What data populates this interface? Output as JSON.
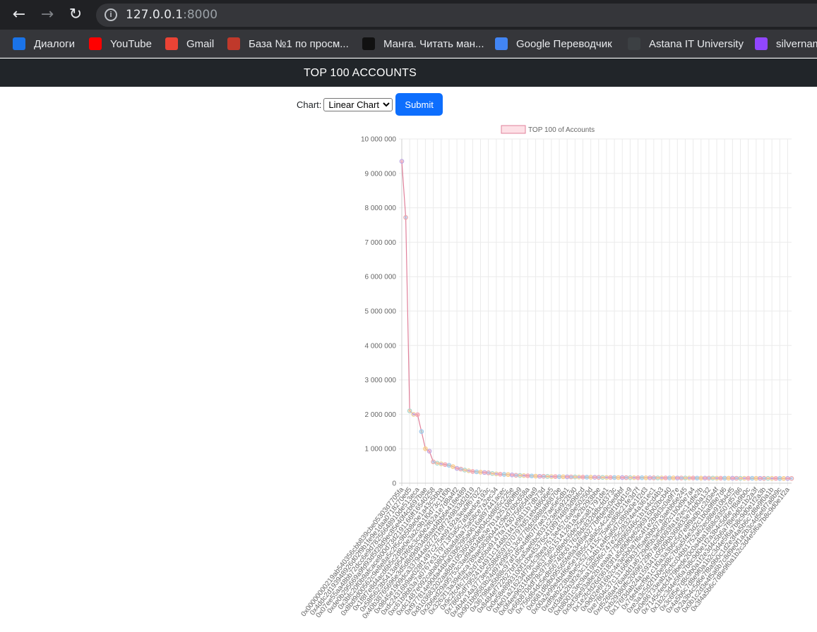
{
  "browser": {
    "url_host": "127.0.0.1",
    "url_port": ":8000",
    "bookmarks": [
      {
        "label": "Диалоги",
        "icon": "chat-icon",
        "color": "#1a73e8"
      },
      {
        "label": "YouTube",
        "icon": "youtube-icon",
        "color": "#ff0000"
      },
      {
        "label": "Gmail",
        "icon": "gmail-icon",
        "color": "#ea4335"
      },
      {
        "label": "База №1 по просм...",
        "icon": "mascot-icon",
        "color": "#c0392b"
      },
      {
        "label": "Манга. Читать ман...",
        "icon": "manga-icon",
        "color": "#111111"
      },
      {
        "label": "Google Переводчик",
        "icon": "translate-icon",
        "color": "#4285f4"
      },
      {
        "label": "Astana IT University",
        "icon": "university-icon",
        "color": "#3c4043"
      },
      {
        "label": "silvernam",
        "icon": "twitch-icon",
        "color": "#9146ff"
      }
    ]
  },
  "navbar": {
    "title": "TOP 100 ACCOUNTS"
  },
  "form": {
    "label": "Chart:",
    "options": [
      "Linear Chart"
    ],
    "selected": "Linear Chart",
    "submit_label": "Submit"
  },
  "chart_data": {
    "type": "line",
    "legend": [
      "TOP 100 of Accounts"
    ],
    "legend_position": "top",
    "ylim": [
      0,
      10000000
    ],
    "yticks": [
      "0",
      "1 000 000",
      "2 000 000",
      "3 000 000",
      "4 000 000",
      "5 000 000",
      "6 000 000",
      "7 000 000",
      "8 000 000",
      "9 000 000",
      "10 000 000"
    ],
    "grid": true,
    "colors": {
      "line": "#e0809a",
      "fill": "#fde0e6"
    },
    "categories": [
      "0x00000000219ab540356cbb839cbe05303d7705fa",
      "0x73bceb1cd57c711feac4224d062b0f6ff338501e",
      "0x4ddc2d193948926d02f9b1fe9e1daa0718270ed5",
      "0x1b3cb81e51011b549d78bf720b0d924ac763a7c2",
      "0x07ee55aa48bb72dcc6e9d78256648910de513eca",
      "0x9778f4e80e4eadeb0d7caa15e8b4a2e4d2c0a3b1",
      "0xde0b295669a9fd93d5f28d9ec85e40f4cb697bae",
      "0xca8fa8f0b631ecdb18cda619c4fc9d197c8affca",
      "0x3bfc20f0b9afcace800d73d2191166ff16540258",
      "0x0a4c79ce84202b03e95b7a692e5d728d83c44c76",
      "0x8bd9d00562c9e8e8a5c2f5c9b5b8e0e1a43c5bba",
      "0x0548f59fee79f8832c299e01dca5c76f034f558e",
      "0x1f8f7e8d4acd6b5c2d8e0e3a2c9b1f0d73c11f0b",
      "0x2faf487a4414fe77e2327f0bf4ae2a264a776ad2",
      "0x58f5623b5413a9542f69c3ca0e2f62a1e7d8a4f2",
      "0x5a52e96bacdabb82fd05763e25335261b270efcb",
      "0x40b38765696e3d5d8d9d834d8aad4bb6e418e489",
      "0x189b9cbd4aff470af2c0102f365fc1823d857965",
      "0x9845e1909dca337944a0272f1f9f7249833d2d19",
      "0xb8808f9e9b88497ec522304055cd537a0913f6a0",
      "0xdc24316b9ae028f1497c275eb9192a3ea0f67022",
      "0x61edcdf5bb737adffe5043706e7c5bb1f1a56eea",
      "0xc61b9bb3a7a0767e3179713f3a5c7a9aedce193c",
      "0x1db92e2eebc8e0c075a02bea49a2935bcd2dfcf4",
      "0xdc1487e092caba080c6badafaa75a58ce7a2ec34",
      "0x7a250d5630b4cf539739df2c5dacb4c659f2488d",
      "0xf977814e90da44bfa03b6295a0616a897441acec",
      "0xe92d1a43df510f82c66382592a047d288f85226f",
      "0x8103683202aa8da10536036edef04cdd865c225e",
      "0x0c23fc0ef06716d2f8ba19bc4bed56d045581f2d",
      "0x2b6ed29a95753c3ad948348e3e7b1a251080ffb9",
      "0x701c484bfb40ac628afa487b6082f084b14af0bd",
      "0x3262f13a39efaca789ae58390441c9ed76bc658a",
      "0x0a869d79a7052c7f1b55a8ebabbea3420f0d1e13",
      "0x9c2fc4fc75fa2d7eb5ba9147fa7430756654faa9",
      "0xb20411c403687d1036e05c8a7310a0f218429503",
      "0x78605df79524164911c144801f41e9811b7db73d",
      "0x36a85757645e8e8aec062a1dee289c7d615901ca",
      "0x4b4e14a3773ee558b6597070797fd51eb48606e5",
      "0xa7e4fecddc20d83f36971b67e13f1abc98dfcfa6",
      "0x901bb9583b24d97e995513c6778dc6888ab6870e",
      "0xc3c7f8e3d8ea35ec3ad8ec1d7b2d0a4b1a3c2e6f",
      "0x36798ea5b88c97af1d5e4dff07f7ae37ae5e5db1",
      "0xe04f27eb70e025b78871a2ad7eabe85e61212761",
      "0x8484ef722627bf18ca5ae6bcf031c23e6e922b30",
      "0x6b44ba0a126a2a1a8aa6cd1adeed002e141bcd44",
      "0x0e58e8993100f1cbe45376c410f97f4893d9bfcd",
      "0x19184ab45c40c2920b0e0e31413b9434abd243ed",
      "0xfe01a216234f79cfc3bea7513e457c6a9e50250d",
      "0x4862733b5fddfd35f35ea8ccf08f5045e57388b3",
      "0x0f4ee9631f4be0a63756515141281a3e2b293bbe",
      "0xbf3aeb96e164ae67e763d9e050ff124e7c3fdd28",
      "0x66b870ddf78c975af5cd8edc6de25eca81791de1",
      "0x8fe78a3f3d3f5a2d5c1c0ab8c7f2b1f2d9f4d2a5",
      "0x756d64dc5edb56740fc617628dc832ddbcfd373c",
      "0xe853c56864a2ebe4576a807d26fdc4a0ada51919",
      "0x0681d8db095565fe8a346fa0277bffde9c0edbbf",
      "0x3ddfa8ec3052539b6c9549f12cea2c295cff5296",
      "0x00a2e99e4b4f6e5e18b5c2a8a5c4c2e8f1b0d1c9",
      "0x7bfee91193d9df2ac0bfe90191d40f23c773c060",
      "0xdf9eb223bafbe5c5271415c75aecd68c21fe3d7f",
      "0xca582d9655a50e6512045740deb0de3a7ee5281f",
      "0xd3a6a2b3f2e3c1c3b4b1e4f5a6d7c8b9a0e1f2d3",
      "0xe0f5b79ef9f748562a21d017bb7a6706954b7585",
      "0xb8001c3ec9aa1985f6c747e25c28324e4a361ec1",
      "0x0716a17fbaee714f1e6ab0f9d59edbc5f09815c0",
      "0x9cf36e93a8e2b1eaaa779d9965f46c1b1e4cd4b3",
      "0x4e9ce36e442e55ecd9025b9a6e0d88485d628a67",
      "0x1e2fcfd26d36183f1a5d90f0e6296915b02bcb40",
      "0x267be1c1d684f78cb4f6a176c4911b741e4ffdc0",
      "0x9d02e6f16b2c4e3e5b0a7f6c4f1e2b8d3c0a9f7e",
      "0x0ab6e8c5f0aed98f9e0a8f1e8b2c6d3a7e9b4c1f",
      "0xe7804c37c13166ff0b37f5ae0bb07a3aebb6e245",
      "0x1c727a55ea3c11b0ab7d3a361fe0f3c47ce6de5d",
      "0xd5268a476aadd1a6729df5b3e5e8f2c1b0d9e7a4",
      "0x9acbb72cf67103a30333a32cd203459c6a9c3311",
      "0xb29380ffc20696729b7ab8d093fa1e2ec14dfe2b",
      "0x8315177ab297ba92a06054ce80a67ed4dbd7ed3a",
      "0x176f3dab24a159341c0509bb36b833e7fdd0a132",
      "0xcdbf58a9a9b54a2c43800c50c7192946de858321",
      "0x7de4fecf9e1c1f0a3a3b6c5d7e8f9a0b1c2d3e4f",
      "0x2f2d854c1d6d5bb8936bb85bc07c28ebb42c9b10",
      "0xe3a3c5d2f1b0e9d8c7b6a5f4e3d2c1b0a9f8e7d6",
      "0x4c7dc1e3b8e6f5d4c3b2a1f0e9d8c7b6a5f4e3d2",
      "0x0e86733eab26cfcc04bb1752a62ec88e910b4cf5",
      "0x6f8a5e4d3c2b1a0f9e8d7c6b5a4f3e2d1c0b9a8e",
      "0x7145cfedcf479bede20c0a4ba1868c93507d5786",
      "0x6e2d5f8c4b3a2e1f0d9c8b7a6f5e4d3c2b1a0f9e",
      "0x1b2c3d4e5f6a7b8c9d0e1f2a3b4c5d6e7f8a9b0c",
      "0x8d12a197cb00d4747a1fe03395095ce2a5cc6819",
      "0x3c6f5e7d8c9b0a1f2e3d4c5b6a7f8e9d0c1b2a3f",
      "0x5f9e8d7c6b5a4f3e2d1c0b9a8f7e6d5c4b3a2f1e",
      "0x4a5b6c7d8e9f0a1b2c3d4e5f6a7b8c9d0e1f2a3b",
      "0x9e8f7a6b5c4d3e2f1a0b9c8d7e6f5a4b3c2d1e0f",
      "0x2a3b4c5d6e7f8a9b0c1d2e3f4a5b6c7d8e9f0a1b",
      "0x6d7e8f9a0b1c2d3e4f5a6b7c8d9e0f1a2b3c4d5e",
      "0x0b1c2d3e4f5a6b7c8d9e0f1a2b3c4d5e6f7a8b9c",
      "0x8e9f0a1b2c3d4e5f6a7b8c9d0e1f2a3b4c5d6e7f",
      "0x3f4a5b6c7d8e9f0a1b2c3d4e5f6a7b8c9d0e1f2a",
      "0x67fd6ec91b11e6008c52a5b74d730698811a3b"
    ],
    "values": [
      9350000,
      7720000,
      2100000,
      2000000,
      1990000,
      1500000,
      1000000,
      930000,
      620000,
      580000,
      560000,
      540000,
      520000,
      480000,
      430000,
      410000,
      380000,
      360000,
      340000,
      330000,
      320000,
      310000,
      300000,
      280000,
      270000,
      260000,
      255000,
      250000,
      240000,
      230000,
      225000,
      220000,
      215000,
      210000,
      205000,
      200000,
      198000,
      195000,
      192000,
      190000,
      188000,
      186000,
      184000,
      182000,
      180000,
      178000,
      176000,
      174000,
      172000,
      170000,
      168000,
      167000,
      166000,
      165000,
      164000,
      163000,
      162000,
      161000,
      160000,
      159000,
      158000,
      157000,
      156000,
      155000,
      154000,
      153500,
      153000,
      152500,
      152000,
      151500,
      151000,
      150500,
      150000,
      149500,
      149000,
      148500,
      148000,
      147500,
      147000,
      146500,
      146000,
      145500,
      145000,
      144500,
      144000,
      143500,
      143000,
      142500,
      142000,
      141500,
      141000,
      140500,
      140000,
      139500,
      139000,
      138500,
      138000,
      137500,
      137000,
      136500
    ]
  }
}
